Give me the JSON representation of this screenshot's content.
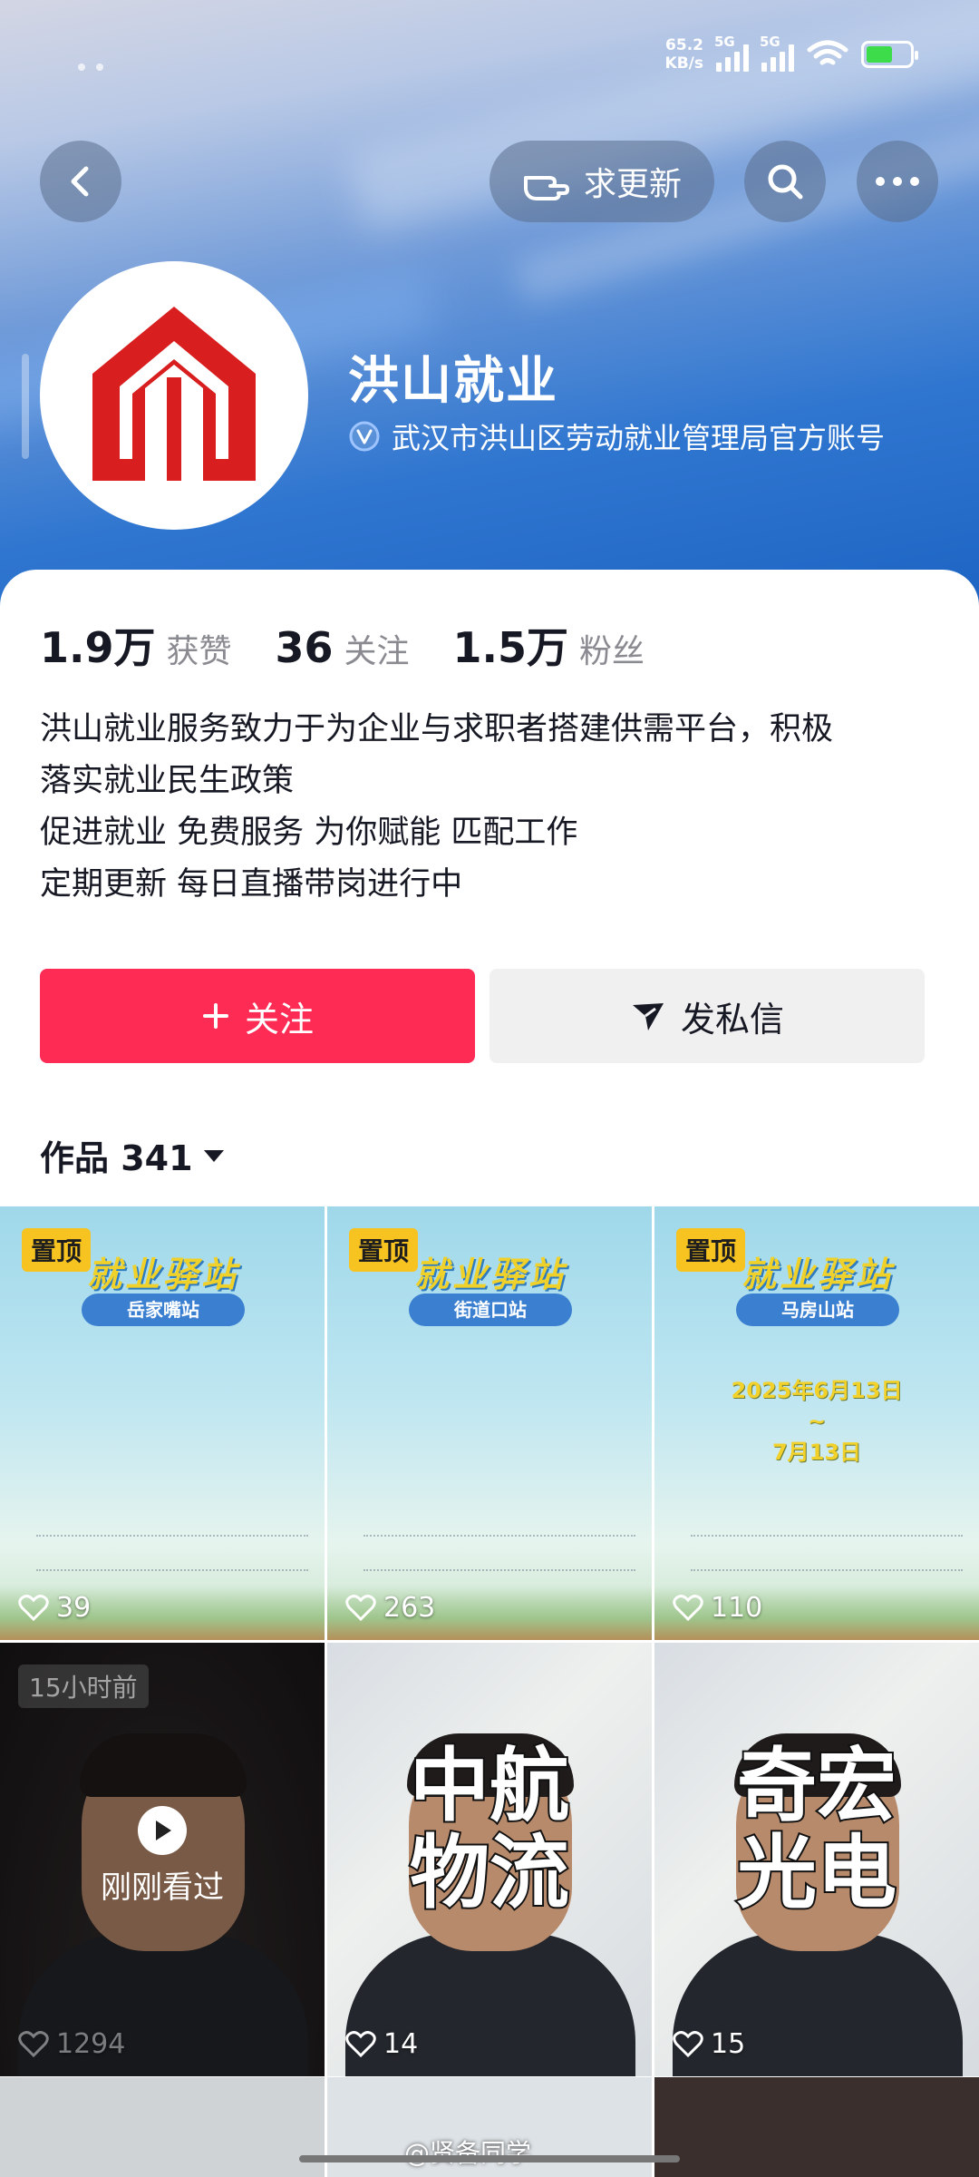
{
  "status_bar": {
    "speed": "65.2",
    "speed_unit": "KB/s",
    "net1": "5G",
    "net2": "5G"
  },
  "nav": {
    "request_update_label": "求更新"
  },
  "profile": {
    "name": "洪山就业",
    "verified_text": "武汉市洪山区劳动就业管理局官方账号",
    "stats": [
      {
        "value": "1.9万",
        "label": "获赞"
      },
      {
        "value": "36",
        "label": "关注"
      },
      {
        "value": "1.5万",
        "label": "粉丝"
      }
    ],
    "bio_lines": [
      "洪山就业服务致力于为企业与求职者搭建供需平台，积极",
      "落实就业民生政策",
      "促进就业 免费服务 为你赋能 匹配工作",
      "定期更新 每日直播带岗进行中"
    ],
    "brand_color": "#d81e1e"
  },
  "actions": {
    "follow_label": "关注",
    "message_label": "发私信",
    "follow_color": "#fe2c55"
  },
  "works": {
    "label": "作品 341"
  },
  "grid": [
    {
      "pinned": "置顶",
      "banner": "就业驿站",
      "station": "岳家嘴站",
      "likes": "39"
    },
    {
      "pinned": "置顶",
      "banner": "就业驿站",
      "station": "街道口站",
      "likes": "263"
    },
    {
      "pinned": "置顶",
      "banner": "就业驿站",
      "station": "马房山站",
      "date_from": "2025年6月13日",
      "date_sep": "~",
      "date_to": "7月13日",
      "likes": "110"
    },
    {
      "ago": "15小时前",
      "watched": "刚刚看过",
      "likes": "1294"
    },
    {
      "overlay": "中航物流",
      "line1": "中航",
      "line2": "物流",
      "likes": "14"
    },
    {
      "overlay": "奇宏光电",
      "line1": "奇宏",
      "line2": "光电",
      "likes": "15"
    }
  ],
  "watermark": "@贤备同学"
}
